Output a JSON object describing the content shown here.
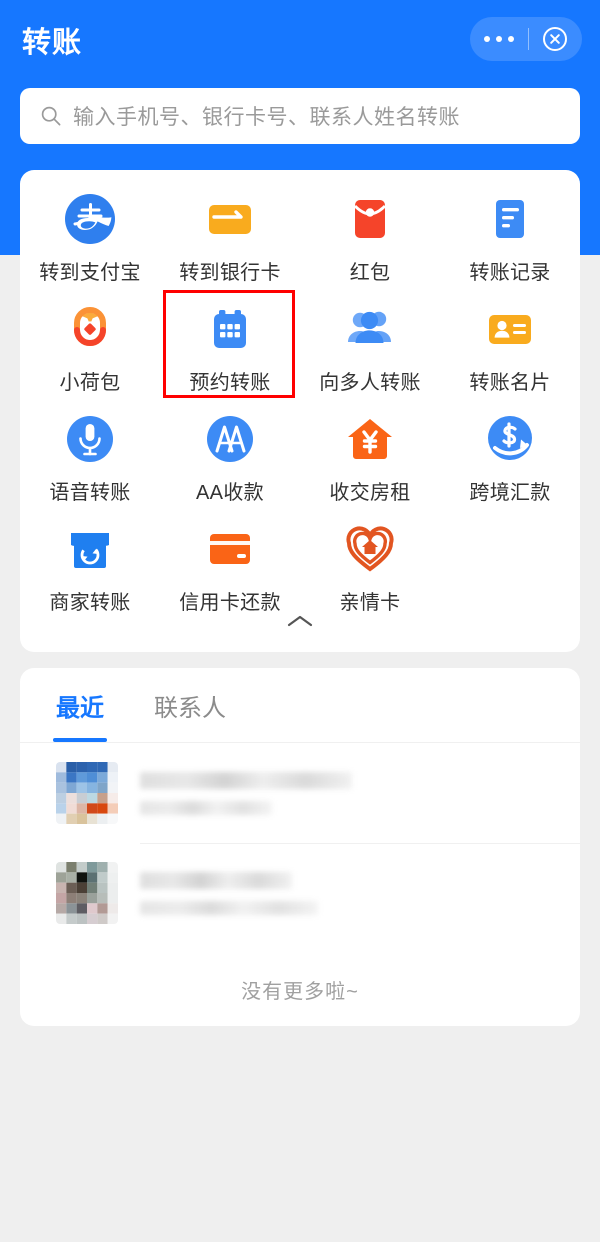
{
  "theme": {
    "brand_blue": "#1677ff",
    "accent_orange": "#f5a623",
    "accent_red": "#f5442a",
    "highlight_red": "#ff0000",
    "page_bg": "#efefef"
  },
  "header": {
    "title": "转账",
    "more_icon": "more-dots-icon",
    "close_icon": "close-circle-icon"
  },
  "search": {
    "icon": "search-icon",
    "placeholder": "输入手机号、银行卡号、联系人姓名转账",
    "value": ""
  },
  "grid": {
    "collapse_icon": "chevron-up-icon",
    "items": [
      {
        "label": "转到支付宝",
        "icon": "alipay-logo-icon",
        "highlighted": false
      },
      {
        "label": "转到银行卡",
        "icon": "bank-card-arrow-icon",
        "highlighted": false
      },
      {
        "label": "红包",
        "icon": "red-envelope-icon",
        "highlighted": false
      },
      {
        "label": "转账记录",
        "icon": "document-list-icon",
        "highlighted": false
      },
      {
        "label": "小荷包",
        "icon": "small-purse-icon",
        "highlighted": false
      },
      {
        "label": "预约转账",
        "icon": "calendar-icon",
        "highlighted": true
      },
      {
        "label": "向多人转账",
        "icon": "multi-people-icon",
        "highlighted": false
      },
      {
        "label": "转账名片",
        "icon": "id-card-icon",
        "highlighted": false
      },
      {
        "label": "语音转账",
        "icon": "microphone-icon",
        "highlighted": false
      },
      {
        "label": "AA收款",
        "icon": "aa-circle-icon",
        "highlighted": false
      },
      {
        "label": "收交房租",
        "icon": "house-yuan-icon",
        "highlighted": false
      },
      {
        "label": "跨境汇款",
        "icon": "dollar-arrow-icon",
        "highlighted": false
      },
      {
        "label": "商家转账",
        "icon": "shop-refresh-icon",
        "highlighted": false
      },
      {
        "label": "信用卡还款",
        "icon": "credit-card-icon",
        "highlighted": false
      },
      {
        "label": "亲情卡",
        "icon": "heart-house-icon",
        "highlighted": false
      }
    ]
  },
  "list": {
    "tabs": [
      {
        "label": "最近",
        "active": true
      },
      {
        "label": "联系人",
        "active": false
      }
    ],
    "rows": [
      {
        "avatar": "avatar-blurred-1",
        "name": "",
        "sub": ""
      },
      {
        "avatar": "avatar-blurred-2",
        "name": "",
        "sub": ""
      }
    ],
    "footer_text": "没有更多啦~"
  }
}
